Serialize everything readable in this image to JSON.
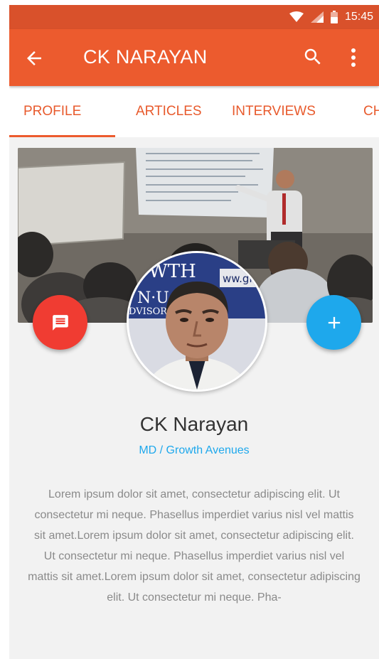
{
  "status_bar": {
    "time": "15:45",
    "icons": [
      "wifi-icon",
      "signal-icon",
      "battery-icon"
    ]
  },
  "app_bar": {
    "title": "CK NARAYAN",
    "back_icon": "arrow-back-icon",
    "search_icon": "search-icon",
    "more_icon": "more-vert-icon"
  },
  "tabs": [
    {
      "label": "PROFILE",
      "selected": true
    },
    {
      "label": "ARTICLES",
      "selected": false
    },
    {
      "label": "INTERVIEWS",
      "selected": false
    },
    {
      "label": "CHAT",
      "selected": false
    }
  ],
  "profile": {
    "name": "CK Narayan",
    "role": "MD / Growth Avenues",
    "bio": "Lorem ipsum dolor sit amet, consectetur adipiscing elit. Ut consectetur mi neque. Phasellus imperdiet varius nisl vel mattis sit amet.Lorem ipsum dolor sit amet, consectetur adipiscing elit. Ut consectetur mi neque. Phasellus imperdiet varius nisl vel mattis sit amet.Lorem ipsum dolor sit amet, consectetur adipiscing elit. Ut consectetur mi neque. Pha-",
    "avatar_banner_text": [
      "WTH",
      "N·U",
      "ww.gr",
      "DVISOR"
    ]
  },
  "actions": {
    "message_icon": "message-icon",
    "add_icon": "add-icon"
  },
  "colors": {
    "status_bar": "#d9512b",
    "app_bar": "#ec5b2e",
    "accent_orange": "#e85a2c",
    "fab_message": "#f03c32",
    "fab_add": "#1ea8ec",
    "role_text": "#1ea8ec",
    "background": "#f2f2f2"
  }
}
